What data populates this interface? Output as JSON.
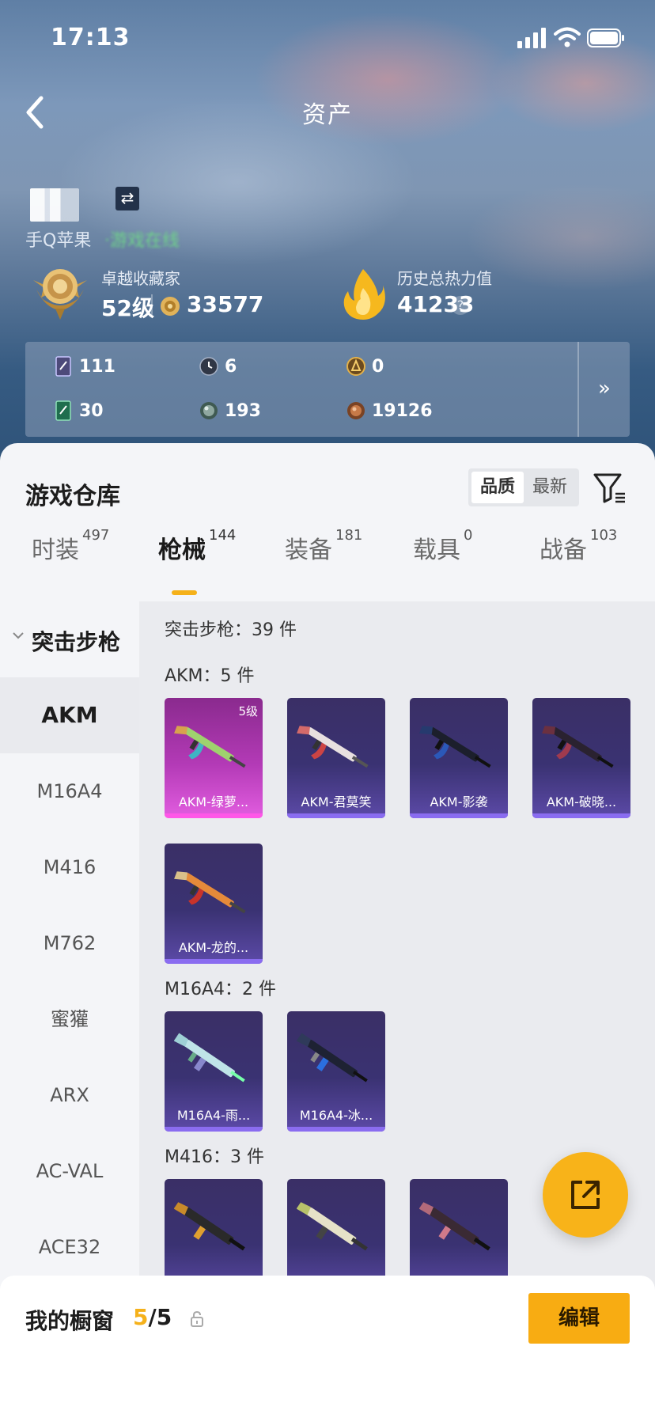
{
  "status_bar": {
    "time": "17:13"
  },
  "header": {
    "title": "资产"
  },
  "profile": {
    "platform": "手Q苹果",
    "online_status": "·游戏在线"
  },
  "collector": {
    "title": "卓越收藏家",
    "level": "52级",
    "points": "33577"
  },
  "heat": {
    "title": "历史总热力值",
    "value": "41233",
    "help": "?"
  },
  "resources": {
    "items": [
      {
        "icon": "card-icon",
        "value": "111"
      },
      {
        "icon": "clock-token-icon",
        "value": "6"
      },
      {
        "icon": "gold-token-icon",
        "value": "0"
      },
      {
        "icon": "green-card-icon",
        "value": "30"
      },
      {
        "icon": "silver-orb-icon",
        "value": "193"
      },
      {
        "icon": "bronze-coin-icon",
        "value": "19126"
      }
    ],
    "more": "»"
  },
  "warehouse": {
    "title": "游戏仓库",
    "sort_options": [
      "品质",
      "最新"
    ]
  },
  "tabs": [
    {
      "label": "时装",
      "count": "497"
    },
    {
      "label": "枪械",
      "count": "144"
    },
    {
      "label": "装备",
      "count": "181"
    },
    {
      "label": "载具",
      "count": "0"
    },
    {
      "label": "战备",
      "count": "103"
    }
  ],
  "nav": {
    "section": "突击步枪",
    "items": [
      "AKM",
      "M16A4",
      "M416",
      "M762",
      "蜜獾",
      "ARX",
      "AC-VAL",
      "ACE32"
    ]
  },
  "content": {
    "total": "突击步枪：39 件",
    "groups": [
      {
        "title": "AKM：5 件",
        "skins": [
          {
            "name": "AKM-绿萝...",
            "level": "5级",
            "rarity": "pink"
          },
          {
            "name": "AKM-君莫笑",
            "rarity": "purple"
          },
          {
            "name": "AKM-影袭",
            "rarity": "purple"
          },
          {
            "name": "AKM-破晓...",
            "rarity": "purple"
          },
          {
            "name": "AKM-龙的...",
            "rarity": "purple"
          }
        ]
      },
      {
        "title": "M16A4：2 件",
        "skins": [
          {
            "name": "M16A4-雨...",
            "rarity": "purple"
          },
          {
            "name": "M16A4-冰...",
            "rarity": "purple"
          }
        ]
      },
      {
        "title": "M416：3 件",
        "skins": [
          {
            "name": "",
            "rarity": "purple"
          },
          {
            "name": "",
            "rarity": "purple"
          },
          {
            "name": "",
            "rarity": "purple"
          }
        ]
      }
    ]
  },
  "showcase": {
    "label": "我的橱窗",
    "count_current": "5",
    "count_total": "/5",
    "edit_button": "编辑"
  },
  "colors": {
    "accent": "#f5b11a",
    "pink_rarity": "#e25de0",
    "purple_rarity": "#5c4aa8"
  }
}
